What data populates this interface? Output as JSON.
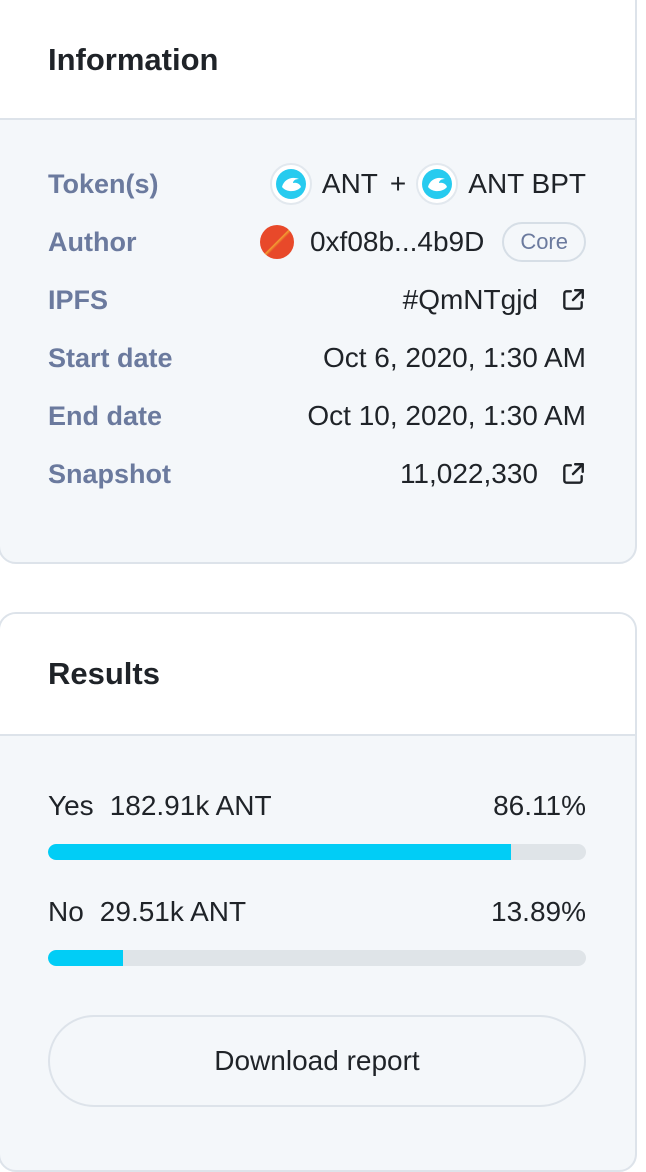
{
  "information": {
    "title": "Information",
    "rows": {
      "tokens": {
        "label": "Token(s)",
        "token1": "ANT",
        "separator": "+",
        "token2": "ANT BPT",
        "token_icon": "aragon-logo-icon"
      },
      "author": {
        "label": "Author",
        "address": "0xf08b...4b9D",
        "badge": "Core",
        "avatar_colors": [
          "#e8492a",
          "#f2a033"
        ]
      },
      "ipfs": {
        "label": "IPFS",
        "value": "#QmNTgjd",
        "icon": "external-link-icon"
      },
      "start_date": {
        "label": "Start date",
        "value": "Oct 6, 2020, 1:30 AM"
      },
      "end_date": {
        "label": "End date",
        "value": "Oct 10, 2020, 1:30 AM"
      },
      "snapshot": {
        "label": "Snapshot",
        "value": "11,022,330",
        "icon": "external-link-icon"
      }
    }
  },
  "results": {
    "title": "Results",
    "items": [
      {
        "choice": "Yes",
        "amount": "182.91k ANT",
        "percent_label": "86.11%",
        "percent": 86.11
      },
      {
        "choice": "No",
        "amount": "29.51k ANT",
        "percent_label": "13.89%",
        "percent": 13.89
      }
    ],
    "download_label": "Download report"
  },
  "colors": {
    "accent": "#01cdf6",
    "label": "#6b7a9e",
    "text": "#1f2328",
    "border": "#dde3ea",
    "panel_bg": "#f4f7fa",
    "track": "#dfe4e8"
  }
}
